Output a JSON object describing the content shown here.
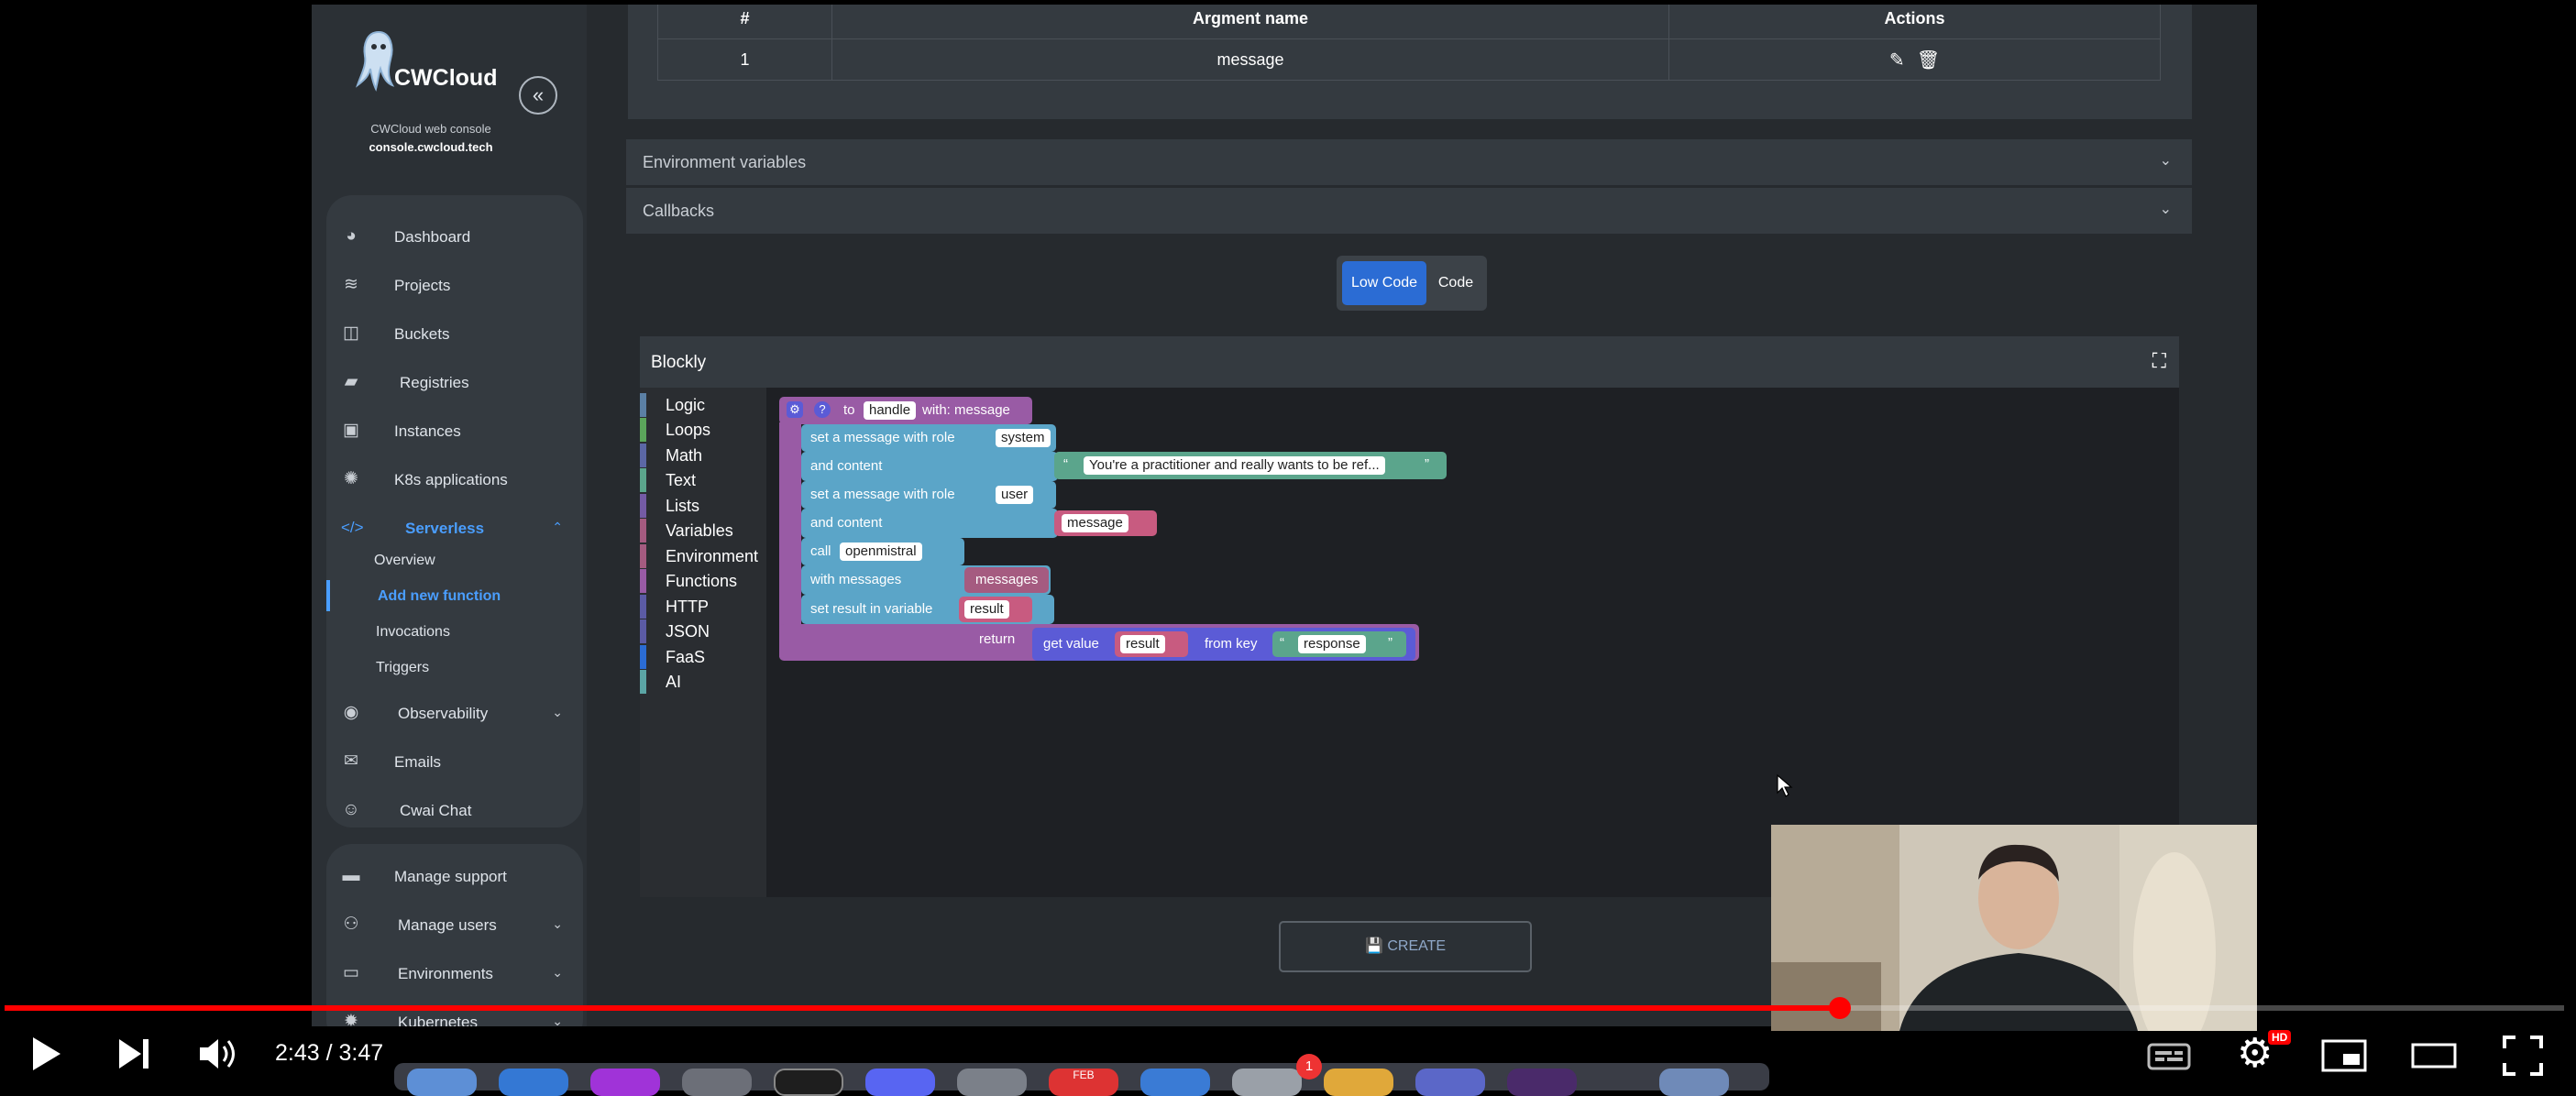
{
  "app": {
    "logo_text": "CWCloud",
    "subtitle": "CWCloud web console",
    "domain": "console.cwcloud.tech"
  },
  "sidebar": {
    "items": [
      {
        "label": "Dashboard",
        "icon": "dashboard-icon"
      },
      {
        "label": "Projects",
        "icon": "layers-icon"
      },
      {
        "label": "Buckets",
        "icon": "bucket-icon"
      },
      {
        "label": "Registries",
        "icon": "docker-icon"
      },
      {
        "label": "Instances",
        "icon": "chip-icon"
      },
      {
        "label": "K8s applications",
        "icon": "helm-icon"
      },
      {
        "label": "Serverless",
        "icon": "code-icon"
      }
    ],
    "serverless_sub": [
      "Overview",
      "Add new function",
      "Invocations",
      "Triggers"
    ],
    "more": [
      {
        "label": "Observability",
        "icon": "eye-icon"
      },
      {
        "label": "Emails",
        "icon": "mail-icon"
      },
      {
        "label": "Cwai Chat",
        "icon": "robot-icon"
      }
    ],
    "admin": [
      {
        "label": "Manage support",
        "icon": "chat-icon"
      },
      {
        "label": "Manage users",
        "icon": "users-icon"
      },
      {
        "label": "Environments",
        "icon": "monitor-icon"
      },
      {
        "label": "Kubernetes",
        "icon": "kubernetes-icon"
      }
    ]
  },
  "args_table": {
    "headers": [
      "#",
      "Argment name",
      "Actions"
    ],
    "rows": [
      {
        "num": "1",
        "name": "message"
      }
    ]
  },
  "accordions": [
    "Environment variables",
    "Callbacks"
  ],
  "mode_toggle": {
    "low_code": "Low Code",
    "code": "Code"
  },
  "blockly": {
    "title": "Blockly",
    "toolbox": [
      {
        "label": "Logic",
        "color": "#5b80a5"
      },
      {
        "label": "Loops",
        "color": "#5ba55b"
      },
      {
        "label": "Math",
        "color": "#5b67a5"
      },
      {
        "label": "Text",
        "color": "#5ba58c"
      },
      {
        "label": "Lists",
        "color": "#745ba5"
      },
      {
        "label": "Variables",
        "color": "#a55b80"
      },
      {
        "label": "Environment",
        "color": "#a55b80"
      },
      {
        "label": "Functions",
        "color": "#995ba5"
      },
      {
        "label": "HTTP",
        "color": "#5b5ba5"
      },
      {
        "label": "JSON",
        "color": "#5b5ba5"
      },
      {
        "label": "FaaS",
        "color": "#2b6cd4"
      },
      {
        "label": "AI",
        "color": "#5ba5a5"
      }
    ],
    "blocks": {
      "to": "to",
      "fn_name": "handle",
      "with": "with: message",
      "set_msg_role": "set a message with role",
      "role_system": "system",
      "and_content": "and content",
      "system_text": "You're a practitioner and really wants to be ref...",
      "role_user": "user",
      "message_var": "message",
      "call": "call",
      "model": "openmistral",
      "with_messages": "with messages",
      "messages_var": "messages",
      "set_result": "set result in variable",
      "result_var": "result",
      "return": "return",
      "get_value": "get value",
      "from_key": "from key",
      "key": "response"
    }
  },
  "create_button": "CREATE",
  "player": {
    "time": "2:43 / 3:47",
    "progress": 0.717,
    "hd_badge": "HD",
    "dock_badge": "1",
    "dock_date": "FEB"
  }
}
